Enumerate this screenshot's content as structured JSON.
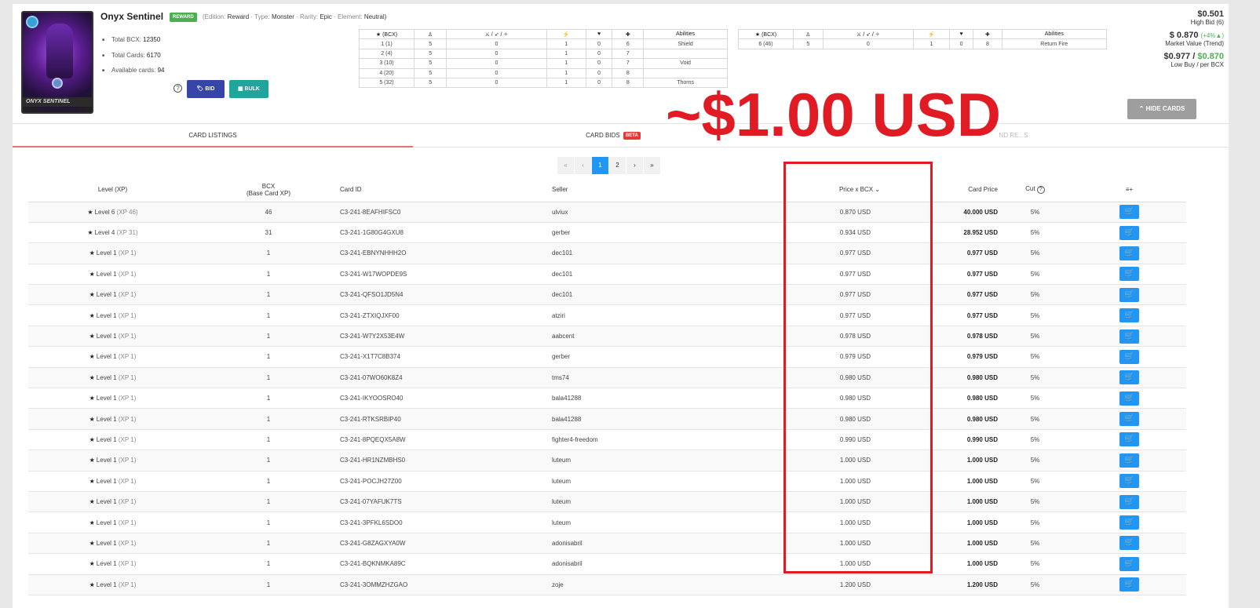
{
  "card": {
    "name": "Onyx Sentinel",
    "badge": "REWARD",
    "edition_label": "(Edition:",
    "edition": "Reward",
    "type_label": "Type:",
    "type": "Monster",
    "rarity_label": "Rarity:",
    "rarity": "Epic",
    "element_label": "Element:",
    "element": "Neutral)",
    "plate_name": "ONYX SENTINEL",
    "level_badge": "6"
  },
  "stats": [
    {
      "label": "Total BCX:",
      "value": "12350"
    },
    {
      "label": "Total Cards:",
      "value": "6170"
    },
    {
      "label": "Available cards:",
      "value": "94"
    }
  ],
  "buttons": {
    "bid": "BID",
    "bulk": "BULK",
    "hide_cards": "HIDE CARDS",
    "help": "?"
  },
  "stat_table_headers": [
    "★ (BCX)",
    "♙",
    "⚔ / ➶ / ✧",
    "⚡",
    "♥",
    "✚",
    "Abilities"
  ],
  "stat_table_left": [
    [
      "1 (1)",
      "5",
      "0",
      "1",
      "0",
      "6",
      "Shield"
    ],
    [
      "2 (4)",
      "5",
      "0",
      "1",
      "0",
      "7",
      ""
    ],
    [
      "3 (10)",
      "5",
      "0",
      "1",
      "0",
      "7",
      "Void"
    ],
    [
      "4 (20)",
      "5",
      "0",
      "1",
      "0",
      "8",
      ""
    ],
    [
      "5 (32)",
      "5",
      "0",
      "1",
      "0",
      "8",
      "Thorns"
    ]
  ],
  "stat_table_right": [
    [
      "6 (46)",
      "5",
      "0",
      "1",
      "0",
      "8",
      "Return Fire"
    ]
  ],
  "market": {
    "high_bid": "$0.501",
    "high_bid_label": "High Bid (6)",
    "market_value": "$ 0.870",
    "trend": "(+4%▲)",
    "market_value_label": "Market Value (Trend)",
    "low_buy": "$0.977",
    "sep": " / ",
    "per_bcx": "$0.870",
    "low_buy_label": "Low Buy / per BCX"
  },
  "overlay": "~$1.00 USD",
  "tabs": {
    "listings": "CARD LISTINGS",
    "bids": "CARD BIDS",
    "beta": "BETA",
    "third": "ND RE...S"
  },
  "pager": [
    "«",
    "‹",
    "1",
    "2",
    "›",
    "»"
  ],
  "columns": {
    "level": "Level (XP)",
    "bcx": "BCX",
    "bcx_sub": "(Base Card XP)",
    "card_id": "Card ID",
    "seller": "Seller",
    "price_bcx": "Price x BCX",
    "card_price": "Card Price",
    "cut": "Cut",
    "actions": "≡+"
  },
  "rows": [
    {
      "level": "Level 6",
      "xp": "(XP 46)",
      "bcx": "46",
      "id": "C3-241-8EAFHIFSC0",
      "seller": "ulviux",
      "pbcx": "0.870 USD",
      "price": "40.000 USD",
      "cut": "5%"
    },
    {
      "level": "Level 4",
      "xp": "(XP 31)",
      "bcx": "31",
      "id": "C3-241-1G80G4GXU8",
      "seller": "gerber",
      "pbcx": "0.934 USD",
      "price": "28.952 USD",
      "cut": "5%"
    },
    {
      "level": "Level 1",
      "xp": "(XP 1)",
      "bcx": "1",
      "id": "C3-241-EBNYNHHH2O",
      "seller": "dec101",
      "pbcx": "0.977 USD",
      "price": "0.977 USD",
      "cut": "5%"
    },
    {
      "level": "Level 1",
      "xp": "(XP 1)",
      "bcx": "1",
      "id": "C3-241-W17WOPDE9S",
      "seller": "dec101",
      "pbcx": "0.977 USD",
      "price": "0.977 USD",
      "cut": "5%"
    },
    {
      "level": "Level 1",
      "xp": "(XP 1)",
      "bcx": "1",
      "id": "C3-241-QFSO1JD5N4",
      "seller": "dec101",
      "pbcx": "0.977 USD",
      "price": "0.977 USD",
      "cut": "5%"
    },
    {
      "level": "Level 1",
      "xp": "(XP 1)",
      "bcx": "1",
      "id": "C3-241-ZTXIQJXF00",
      "seller": "atziri",
      "pbcx": "0.977 USD",
      "price": "0.977 USD",
      "cut": "5%"
    },
    {
      "level": "Level 1",
      "xp": "(XP 1)",
      "bcx": "1",
      "id": "C3-241-W7Y2X53E4W",
      "seller": "aabcent",
      "pbcx": "0.978 USD",
      "price": "0.978 USD",
      "cut": "5%"
    },
    {
      "level": "Level 1",
      "xp": "(XP 1)",
      "bcx": "1",
      "id": "C3-241-X1T7C8B374",
      "seller": "gerber",
      "pbcx": "0.979 USD",
      "price": "0.979 USD",
      "cut": "5%"
    },
    {
      "level": "Level 1",
      "xp": "(XP 1)",
      "bcx": "1",
      "id": "C3-241-07WO60K8Z4",
      "seller": "tms74",
      "pbcx": "0.980 USD",
      "price": "0.980 USD",
      "cut": "5%"
    },
    {
      "level": "Level 1",
      "xp": "(XP 1)",
      "bcx": "1",
      "id": "C3-241-IKYOOSRO40",
      "seller": "bala41288",
      "pbcx": "0.980 USD",
      "price": "0.980 USD",
      "cut": "5%"
    },
    {
      "level": "Level 1",
      "xp": "(XP 1)",
      "bcx": "1",
      "id": "C3-241-RTKSRBIP40",
      "seller": "bala41288",
      "pbcx": "0.980 USD",
      "price": "0.980 USD",
      "cut": "5%"
    },
    {
      "level": "Level 1",
      "xp": "(XP 1)",
      "bcx": "1",
      "id": "C3-241-8PQEQX5A8W",
      "seller": "fighter4-freedom",
      "pbcx": "0.990 USD",
      "price": "0.990 USD",
      "cut": "5%"
    },
    {
      "level": "Level 1",
      "xp": "(XP 1)",
      "bcx": "1",
      "id": "C3-241-HR1NZMBHS0",
      "seller": "luteum",
      "pbcx": "1.000 USD",
      "price": "1.000 USD",
      "cut": "5%"
    },
    {
      "level": "Level 1",
      "xp": "(XP 1)",
      "bcx": "1",
      "id": "C3-241-POCJH27Z00",
      "seller": "luteum",
      "pbcx": "1.000 USD",
      "price": "1.000 USD",
      "cut": "5%"
    },
    {
      "level": "Level 1",
      "xp": "(XP 1)",
      "bcx": "1",
      "id": "C3-241-07YAFUK7TS",
      "seller": "luteum",
      "pbcx": "1.000 USD",
      "price": "1.000 USD",
      "cut": "5%"
    },
    {
      "level": "Level 1",
      "xp": "(XP 1)",
      "bcx": "1",
      "id": "C3-241-3PFKL6SDO0",
      "seller": "luteum",
      "pbcx": "1.000 USD",
      "price": "1.000 USD",
      "cut": "5%"
    },
    {
      "level": "Level 1",
      "xp": "(XP 1)",
      "bcx": "1",
      "id": "C3-241-G8ZAGXYA0W",
      "seller": "adonisabril",
      "pbcx": "1.000 USD",
      "price": "1.000 USD",
      "cut": "5%"
    },
    {
      "level": "Level 1",
      "xp": "(XP 1)",
      "bcx": "1",
      "id": "C3-241-BQKNMKA89C",
      "seller": "adonisabril",
      "pbcx": "1.000 USD",
      "price": "1.000 USD",
      "cut": "5%"
    },
    {
      "level": "Level 1",
      "xp": "(XP 1)",
      "bcx": "1",
      "id": "C3-241-3OMMZHZGAO",
      "seller": "zoje",
      "pbcx": "1.200 USD",
      "price": "1.200 USD",
      "cut": "5%"
    }
  ],
  "colors": {
    "accent": "#2196f3",
    "bid": "#3745a8",
    "bulk": "#1fa59b",
    "overlay": "#e01b24",
    "green": "#4caf50"
  }
}
